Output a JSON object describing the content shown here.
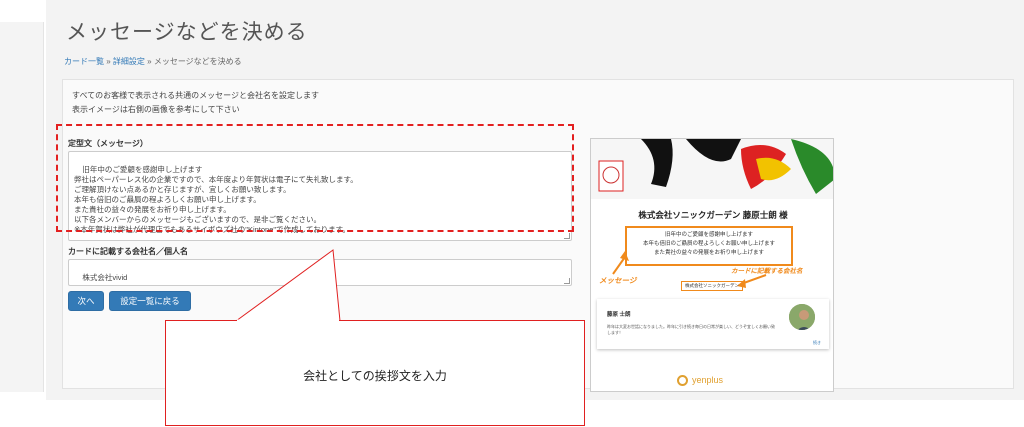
{
  "page": {
    "title": "メッセージなどを決める",
    "breadcrumb": {
      "items": [
        "カード一覧",
        "詳細設定",
        "メッセージなどを決める"
      ],
      "separator": "»"
    },
    "description": [
      "すべてのお客様で表示される共通のメッセージと会社名を設定します",
      "表示イメージは右側の画像を参考にして下さい"
    ]
  },
  "form": {
    "message_label": "定型文（メッセージ）",
    "message_value": "旧年中のご愛顧を感謝申し上げます\n弊社はペーパーレス化の企業ですので、本年度より年賀状は電子にて失礼致します。\nご理解頂けない点あるかと存じますが、宜しくお願い致します。\n本年も倍旧のご贔屓の程よろしくお願い申し上げます。\nまた貴社の益々の発展をお祈り申し上げます。\n以下各メンバーからのメッセージもございますので、是非ご覧ください。\n※本年賀状は弊社が代理店でもあるサイボウズ社の\"Kintone\"で作成しております。",
    "company_label": "カードに記載する会社名／個人名",
    "company_value": "株式会社vivid",
    "next_button": "次へ",
    "back_button": "設定一覧に戻る"
  },
  "callout": {
    "text": "会社としての挨拶文を入力"
  },
  "preview": {
    "company_title": "株式会社ソニックガーデン 藤原士朗 様",
    "message_lines": [
      "旧年中のご愛顧を感謝申し上げます",
      "本年も倍旧のご贔屓の程よろしくお願い申し上げます",
      "また貴社の益々の発展をお祈り申し上げます"
    ],
    "message_annotation": "メッセージ",
    "company_annotation": "カードに記載する会社名",
    "company_box": "株式会社ソニックガーデン",
    "profile_name": "藤原 士朗",
    "profile_message": "昨年は大変お世話になりました。昨年に引き続き毎日の日常が楽しい、どうぞ宜しくお願い致します！",
    "profile_link": "続き",
    "footer_brand": "yenplus"
  },
  "colors": {
    "link": "#337ab7",
    "button": "#337ab7",
    "highlight": "#e32020",
    "preview_accent": "#f08a1c"
  }
}
